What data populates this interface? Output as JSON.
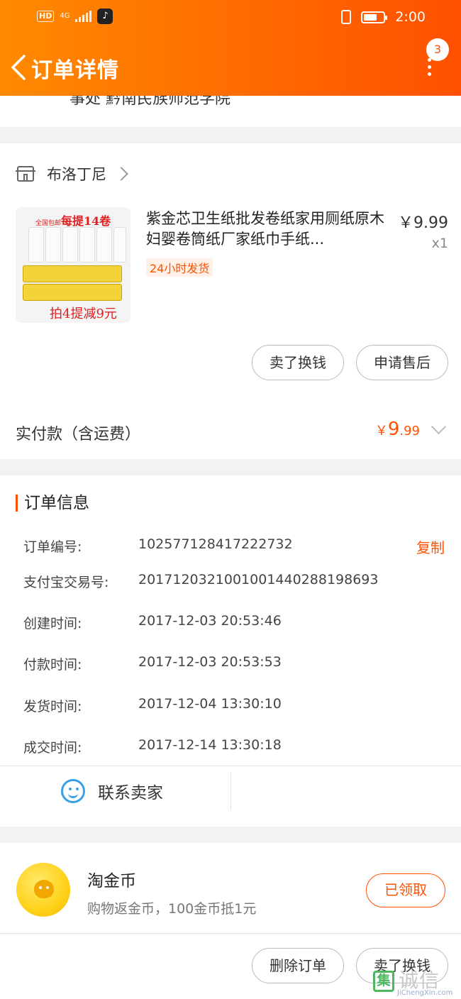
{
  "status_bar": {
    "hd": "HD",
    "network": "4G",
    "time": "2:00"
  },
  "header": {
    "title": "订单详情",
    "badge_count": "3"
  },
  "address_tail": "事处 黔南民族师范学院",
  "shop": {
    "name": "布洛丁尼"
  },
  "product": {
    "title": "紫金芯卫生纸批发卷纸家用厕纸原木妇婴卷筒纸厂家纸巾手纸...",
    "tag": "24小时发货",
    "price": "￥9.99",
    "quantity": "x1",
    "thumb_top_small": "全国包邮",
    "thumb_top_text": "每提14卷",
    "thumb_bottom_text": "拍4提减9元"
  },
  "order_actions": {
    "sell_label": "卖了换钱",
    "aftersale_label": "申请售后"
  },
  "payment": {
    "label": "实付款（含运费）",
    "currency": "￥",
    "amount_int": "9",
    "amount_dec": ".99"
  },
  "order_info": {
    "title": "订单信息",
    "copy_label": "复制",
    "rows": [
      {
        "label": "订单编号:",
        "value": "102577128417222732"
      },
      {
        "label": "支付宝交易号:",
        "value": "2017120321001001440288198693"
      },
      {
        "label": "创建时间:",
        "value": "2017-12-03 20:53:46"
      },
      {
        "label": "付款时间:",
        "value": "2017-12-03 20:53:53"
      },
      {
        "label": "发货时间:",
        "value": "2017-12-04 13:30:10"
      },
      {
        "label": "成交时间:",
        "value": "2017-12-14 13:30:18"
      }
    ],
    "contact_label": "联系卖家"
  },
  "coins": {
    "title": "淘金币",
    "subtitle": "购物返金币，100金币抵1元",
    "claimed_label": "已领取"
  },
  "bottom_actions": {
    "delete_label": "删除订单",
    "sell_label": "卖了换钱"
  },
  "watermark": {
    "box": "集",
    "big": "诚信",
    "small": "JiChengXin.com"
  },
  "colors": {
    "accent": "#ff5000",
    "header_start": "#ff8a00",
    "link_blue": "#39a0e6"
  }
}
